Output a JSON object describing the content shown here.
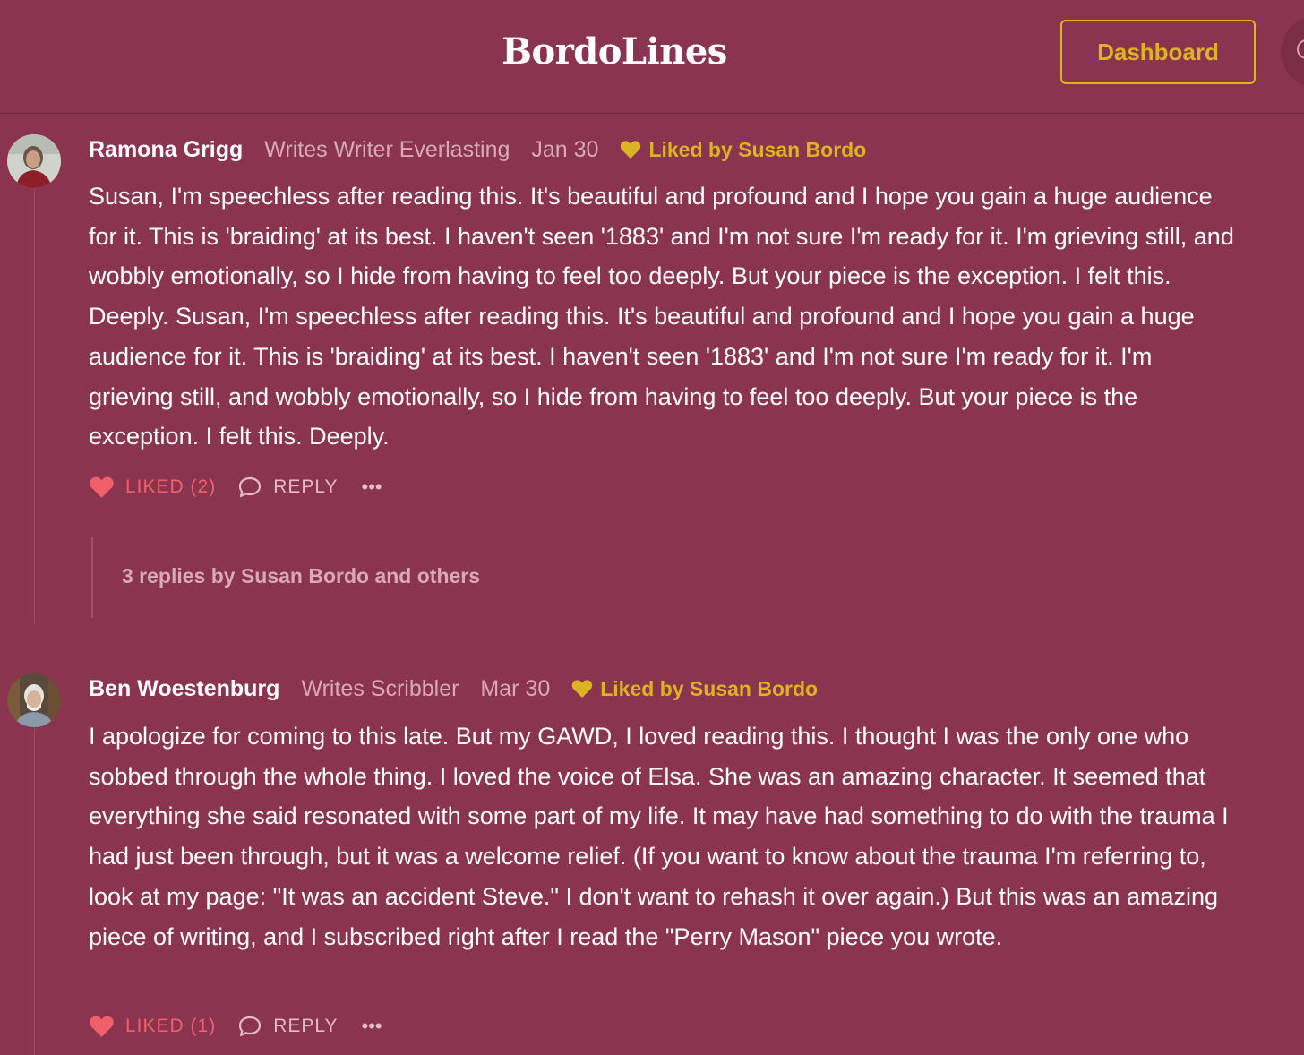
{
  "header": {
    "site_title": "BordoLines",
    "dashboard_label": "Dashboard"
  },
  "comments": [
    {
      "author": "Ramona Grigg",
      "writes": "Writes Writer Everlasting",
      "date": "Jan 30",
      "liked_by": "Liked by Susan Bordo",
      "body": "Susan, I'm speechless after reading this. It's beautiful and profound and I hope you gain a huge audience for it. This is 'braiding' at its best. I haven't seen '1883' and I'm not sure I'm ready for it. I'm grieving still, and wobbly emotionally, so I hide from having to feel too deeply. But your piece is the exception. I felt this. Deeply. Susan, I'm speechless after reading this. It's beautiful and profound and I hope you gain a huge audience for it. This is 'braiding' at its best. I haven't seen '1883' and I'm not sure I'm ready for it. I'm grieving still, and wobbly emotionally, so I hide from having to feel too deeply. But your piece is the exception. I felt this. Deeply.",
      "like_label": "LIKED (2)",
      "reply_label": "REPLY",
      "more_label": "•••",
      "replies_summary": "3 replies by Susan Bordo and others"
    },
    {
      "author": "Ben Woestenburg",
      "writes": "Writes Scribbler",
      "date": "Mar 30",
      "liked_by": "Liked by Susan Bordo",
      "body": "I apologize for coming to this late. But my GAWD, I loved reading this. I thought I was the only one who sobbed through the whole thing. I loved the voice of Elsa. She was an amazing character. It seemed that everything she said resonated with some part of my life. It may have had something to do with the trauma I had just been through, but it was a welcome relief. (If you want to know about the trauma I'm referring to, look at my page: \"It was an accident Steve.\" I don't want to rehash it over again.) But this was an amazing piece of writing, and I subscribed right after I read the \"Perry Mason\" piece you wrote.",
      "like_label": "LIKED (1)",
      "reply_label": "REPLY",
      "more_label": "•••"
    }
  ],
  "colors": {
    "background": "#8a344f",
    "accent_gold": "#dcb323",
    "liked_red": "#f0606a",
    "muted_pink": "#d9a9b7"
  },
  "icons": [
    "heart-icon",
    "comment-bubble-icon",
    "more-dots-icon",
    "gold-heart-icon"
  ]
}
